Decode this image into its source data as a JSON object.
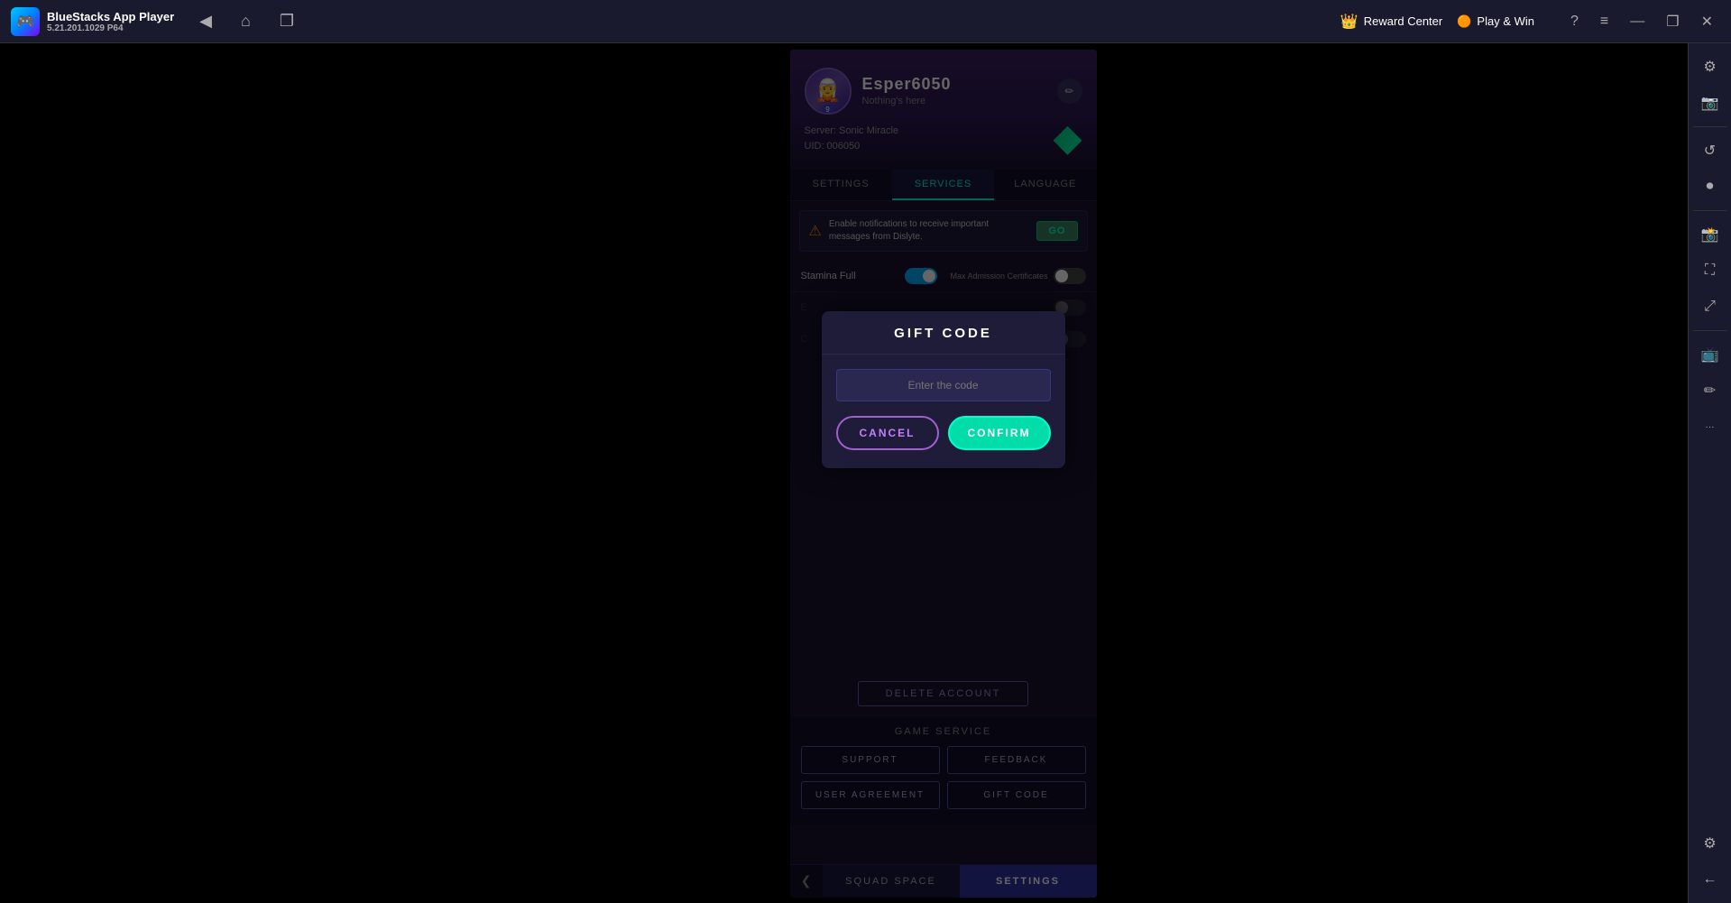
{
  "app": {
    "title": "BlueStacks App Player",
    "version": "5.21.201.1029  P64"
  },
  "topbar": {
    "nav": {
      "back_label": "◀",
      "home_label": "⌂",
      "multi_label": "❐"
    },
    "reward_center_label": "Reward Center",
    "play_win_label": "Play & Win",
    "help_label": "?",
    "menu_label": "≡",
    "minimize_label": "—",
    "maximize_label": "❐",
    "close_label": "✕"
  },
  "profile": {
    "username": "Esper6050",
    "subtitle": "Nothing's here",
    "server_label": "Server: Sonic Miracle",
    "uid_label": "UID: 006050",
    "badge": "9"
  },
  "tabs": [
    {
      "id": "settings",
      "label": "SETTINGS"
    },
    {
      "id": "services",
      "label": "SERVICES",
      "active": true
    },
    {
      "id": "language",
      "label": "LANGUAGE"
    }
  ],
  "notification": {
    "text": "Enable notifications to receive important messages from Dislyte.",
    "go_label": "GO"
  },
  "toggles": [
    {
      "label": "Stamina Full",
      "state": "on"
    },
    {
      "label": "Max Admission Certificates",
      "state": "off"
    }
  ],
  "gift_dialog": {
    "title": "GIFT CODE",
    "input_placeholder": "Enter the code",
    "cancel_label": "CANCEL",
    "confirm_label": "CONFIRM"
  },
  "delete_account": {
    "label": "DELETE ACCOUNT"
  },
  "game_service": {
    "title": "GAME SERVICE",
    "buttons": [
      {
        "label": "SUPPORT"
      },
      {
        "label": "FEEDBACK"
      },
      {
        "label": "USER AGREEMENT"
      },
      {
        "label": "GIFT CODE"
      }
    ]
  },
  "bottom_nav": {
    "arrow_label": "❮",
    "squad_space_label": "SQUAD SPACE",
    "settings_label": "SETTINGS"
  },
  "sidebar_icons": [
    {
      "name": "settings-icon",
      "symbol": "⚙"
    },
    {
      "name": "camera-icon",
      "symbol": "📷"
    },
    {
      "name": "refresh-icon",
      "symbol": "↺"
    },
    {
      "name": "record-icon",
      "symbol": "⏺"
    },
    {
      "name": "screenshot-icon",
      "symbol": "📸"
    },
    {
      "name": "fullscreen-icon",
      "symbol": "⛶"
    },
    {
      "name": "resize-icon",
      "symbol": "⤢"
    },
    {
      "name": "tv-icon",
      "symbol": "📺"
    },
    {
      "name": "edit-icon",
      "symbol": "✏"
    },
    {
      "name": "more-icon",
      "symbol": "···"
    },
    {
      "name": "gear-icon",
      "symbol": "⚙"
    },
    {
      "name": "arrow-left-icon",
      "symbol": "←"
    }
  ]
}
